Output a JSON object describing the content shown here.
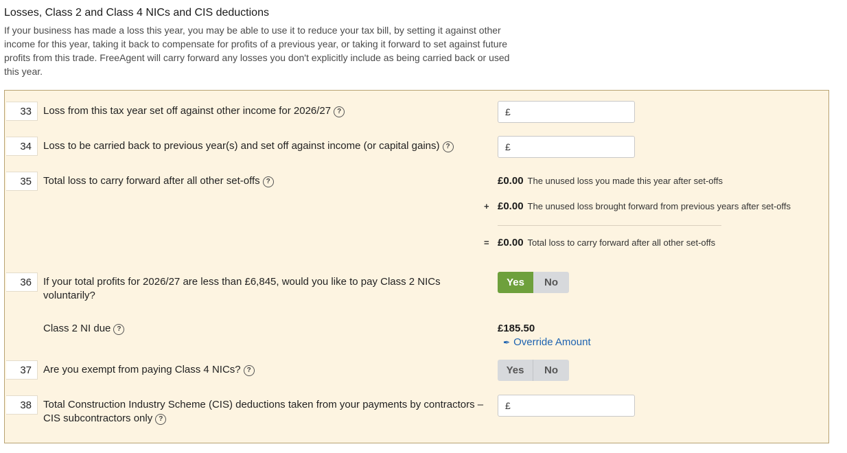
{
  "header": {
    "title": "Losses, Class 2 and Class 4 NICs and CIS deductions",
    "description": "If your business has made a loss this year, you may be able to use it to reduce your tax bill, by setting it against other income for this year, taking it back to compensate for profits of a previous year, or taking it forward to set against future profits from this trade. FreeAgent will carry forward any losses you don't explicitly include as being carried back or used this year."
  },
  "currency_symbol": "£",
  "help_glyph": "?",
  "rows": {
    "r33": {
      "number": "33",
      "label": "Loss from this tax year set off against other income for 2026/27",
      "value": ""
    },
    "r34": {
      "number": "34",
      "label": "Loss to be carried back to previous year(s) and set off against income (or capital gains)",
      "value": ""
    },
    "r35": {
      "number": "35",
      "label": "Total loss to carry forward after all other set-offs",
      "lines": [
        {
          "op": "",
          "amount": "£0.00",
          "text": "The unused loss you made this year after set-offs"
        },
        {
          "op": "+",
          "amount": "£0.00",
          "text": "The unused loss brought forward from previous years after set-offs"
        },
        {
          "op": "=",
          "amount": "£0.00",
          "text": "Total loss to carry forward after all other set-offs"
        }
      ]
    },
    "r36": {
      "number": "36",
      "label": "If your total profits for 2026/27 are less than £6,845, would you like to pay Class 2 NICs voluntarily?",
      "yes_label": "Yes",
      "no_label": "No",
      "selected": "Yes"
    },
    "class2": {
      "label": "Class 2 NI due",
      "amount": "£185.50",
      "override_label": "Override Amount"
    },
    "r37": {
      "number": "37",
      "label": "Are you exempt from paying Class 4 NICs?",
      "yes_label": "Yes",
      "no_label": "No",
      "selected": ""
    },
    "r38": {
      "number": "38",
      "label": "Total Construction Industry Scheme (CIS) deductions taken from your payments by contractors – CIS subcontractors only",
      "value": ""
    }
  },
  "colors": {
    "panel_bg": "#fdf4e1",
    "panel_border": "#b8a272",
    "toggle_active": "#6ea03c",
    "toggle_inactive": "#d7d9dc",
    "link": "#1d62b0"
  }
}
